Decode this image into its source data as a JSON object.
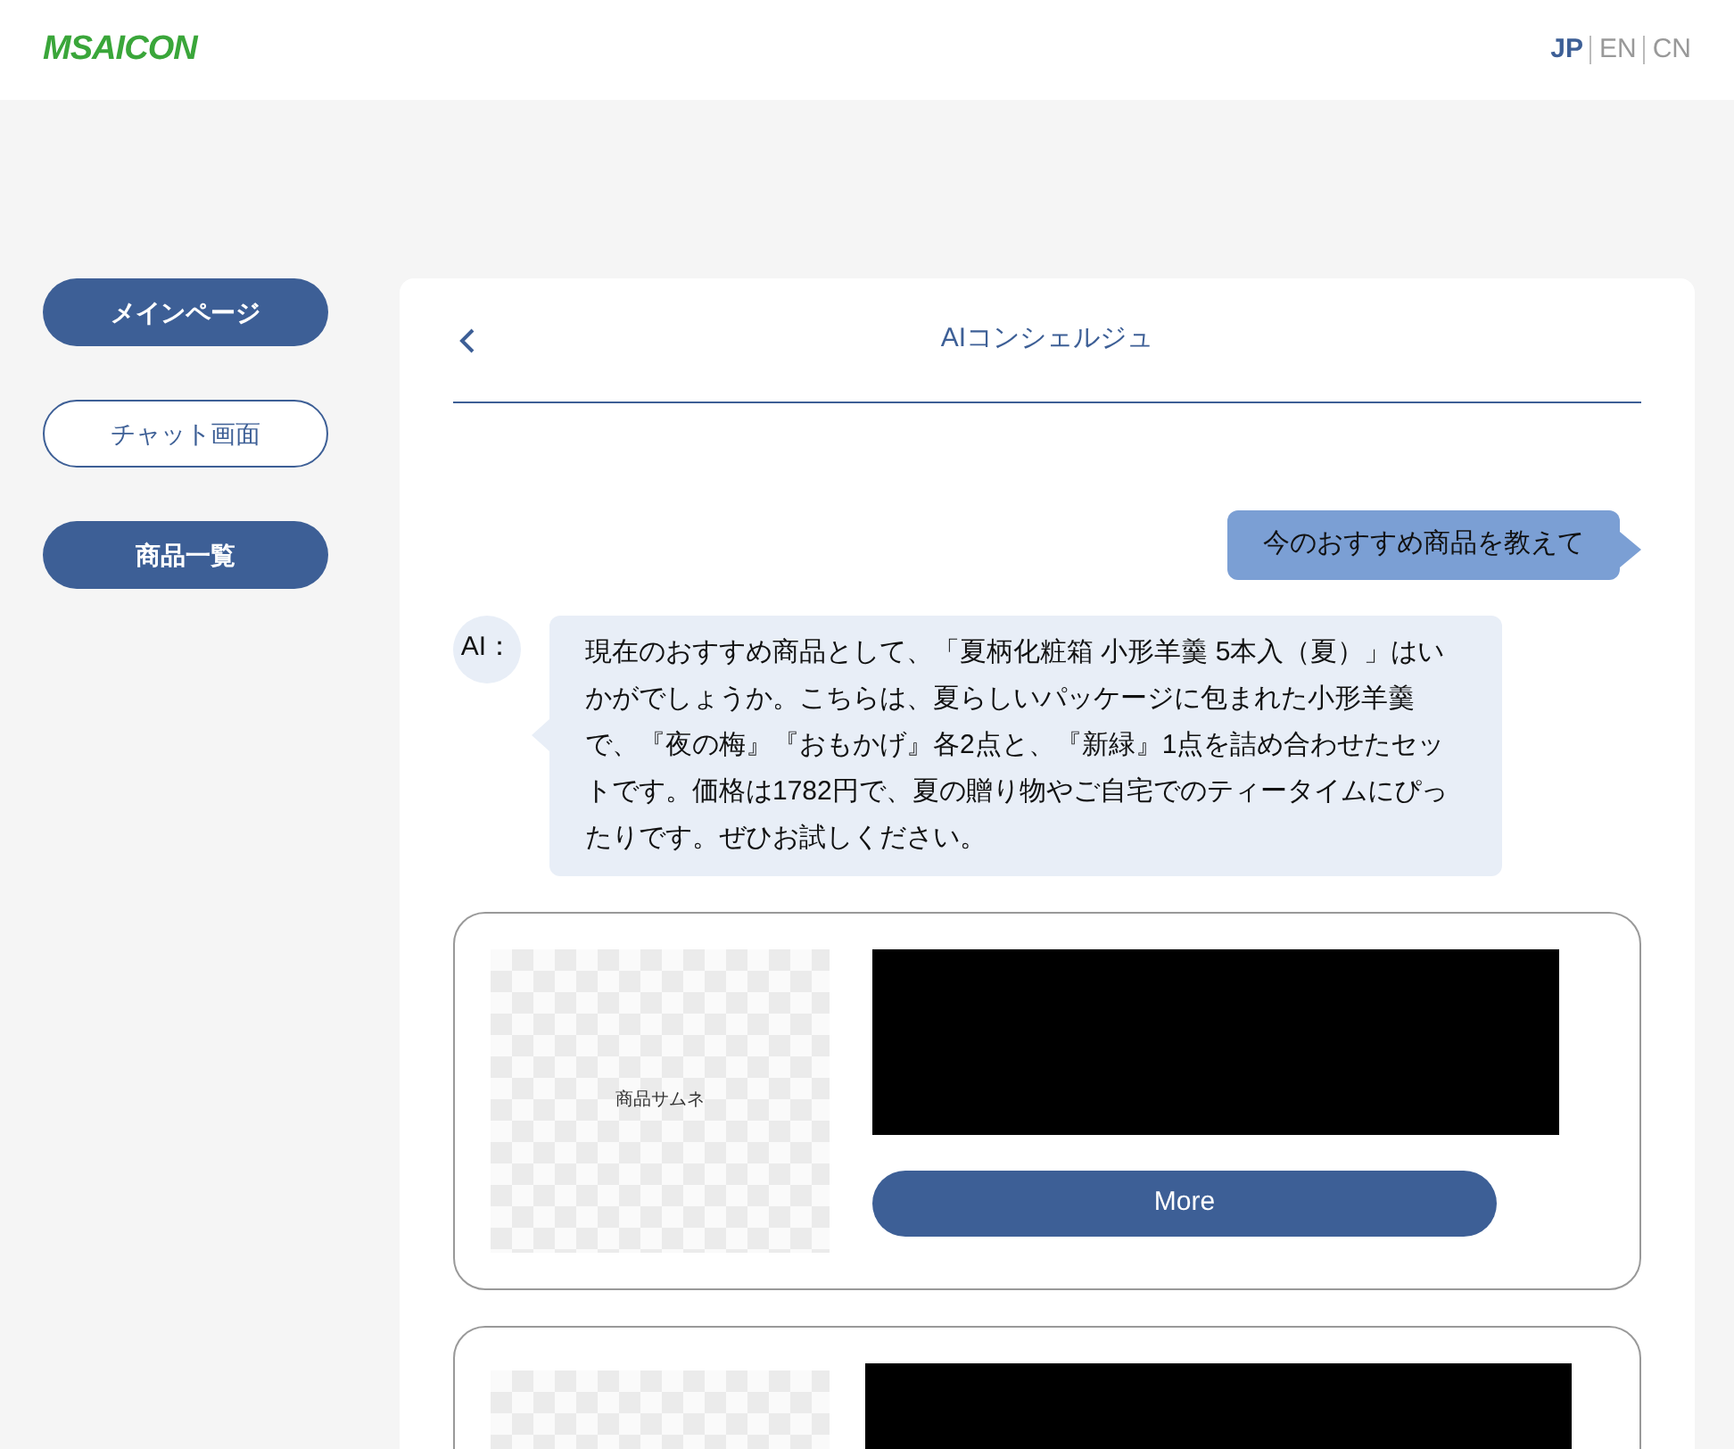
{
  "logo": "MSAICON",
  "languages": [
    {
      "label": "JP",
      "selected": true
    },
    {
      "label": "EN",
      "selected": false
    },
    {
      "label": "CN",
      "selected": false
    }
  ],
  "nav": [
    {
      "label": "メインページ",
      "selected": false
    },
    {
      "label": "チャット画面",
      "selected": true
    },
    {
      "label": "商品一覧",
      "selected": false
    }
  ],
  "chat": {
    "title": "AIコンシェルジュ",
    "messages": [
      {
        "kind": "user",
        "text": "今のおすすめ商品を教えて"
      },
      {
        "kind": "ai",
        "speaker": "AI：",
        "text": "現在のおすすめ商品として、「夏柄化粧箱 小形羊羹 5本入（夏）」はいかがでしょうか。こちらは、夏らしいパッケージに包まれた小形羊羹で、『夜の梅』『おもかげ』各2点と、『新緑』1点を詰め合わせたセットです。価格は1782円で、夏の贈り物やご自宅でのティータイムにぴったりです。ぜひお試しください。"
      }
    ],
    "products": [
      {
        "kind": "full",
        "thumbnail_label": "商品サムネ",
        "button": "More"
      },
      {
        "kind": "partial"
      }
    ]
  }
}
